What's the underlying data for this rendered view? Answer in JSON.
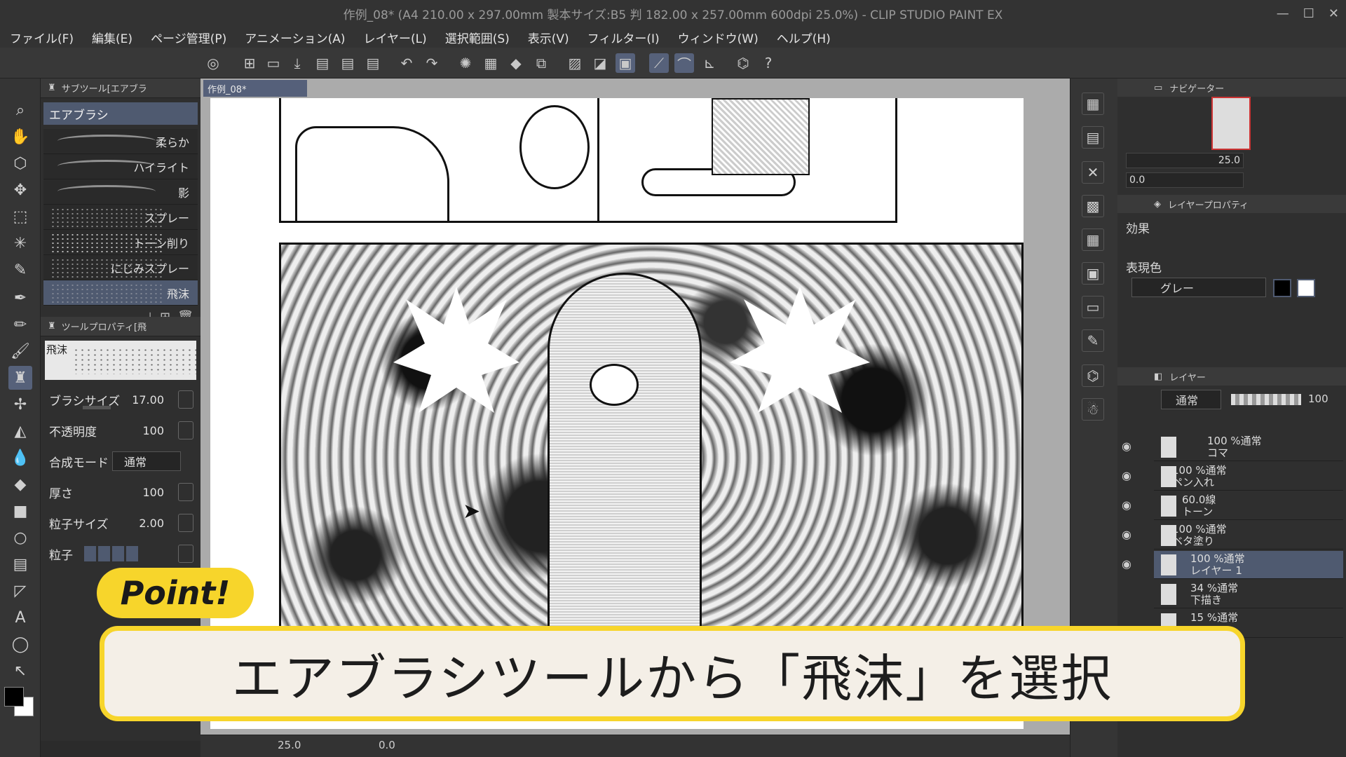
{
  "window": {
    "title": "作例_08* (A4 210.00 x 297.00mm 製本サイズ:B5 判 182.00 x 257.00mm 600dpi 25.0%) - CLIP STUDIO PAINT EX",
    "controls": [
      "—",
      "☐",
      "✕"
    ]
  },
  "menu": [
    "ファイル(F)",
    "編集(E)",
    "ページ管理(P)",
    "アニメーション(A)",
    "レイヤー(L)",
    "選択範囲(S)",
    "表示(V)",
    "フィルター(I)",
    "ウィンドウ(W)",
    "ヘルプ(H)"
  ],
  "subtool_panel": {
    "header": "サブツール[エアブラ",
    "group": "エアブラシ",
    "brushes": [
      "柔らか",
      "ハイライト",
      "影",
      "スプレー",
      "トーン削り",
      "にじみスプレー",
      "飛沫"
    ],
    "selected": "飛沫"
  },
  "tool_property": {
    "header": "ツールプロパティ[飛",
    "preview_label": "飛沫",
    "brush_size_label": "ブラシサイズ",
    "brush_size_value": "17.00",
    "opacity_label": "不透明度",
    "opacity_value": "100",
    "blend_label": "合成モード",
    "blend_value": "通常",
    "thickness_label": "厚さ",
    "thickness_value": "100",
    "particle_size_label": "粒子サイズ",
    "particle_size_value": "2.00",
    "particle_label": "粒子"
  },
  "document": {
    "tab": "作例_08*"
  },
  "navigator": {
    "header": "ナビゲーター",
    "zoom": "25.0",
    "rotate": "0.0"
  },
  "layer_property": {
    "header": "レイヤープロパティ",
    "effect_label": "効果",
    "color_label": "表現色",
    "color_value": "グレー"
  },
  "layer_panel": {
    "header": "レイヤー",
    "blend": "通常",
    "opacity": "100",
    "layers": [
      {
        "line1": "100 %通常",
        "line2": "コマ"
      },
      {
        "line1": "100 %通常",
        "line2": "ペン入れ"
      },
      {
        "line1": "60.0線",
        "line2": "トーン"
      },
      {
        "line1": "100 %通常",
        "line2": "ベタ塗り"
      },
      {
        "line1": "100 %通常",
        "line2": "レイヤー 1"
      },
      {
        "line1": "34 %通常",
        "line2": "下描き"
      },
      {
        "line1": "15 %通常",
        "line2": ""
      }
    ]
  },
  "status": {
    "zoom": "25.0",
    "angle": "0.0"
  },
  "overlay": {
    "badge": "Point!",
    "caption": "エアブラシツールから「飛沫」を選択"
  },
  "colors": {
    "accent": "#4f5a70",
    "badge": "#f7d52b",
    "caption_bg": "#f4efe7"
  }
}
